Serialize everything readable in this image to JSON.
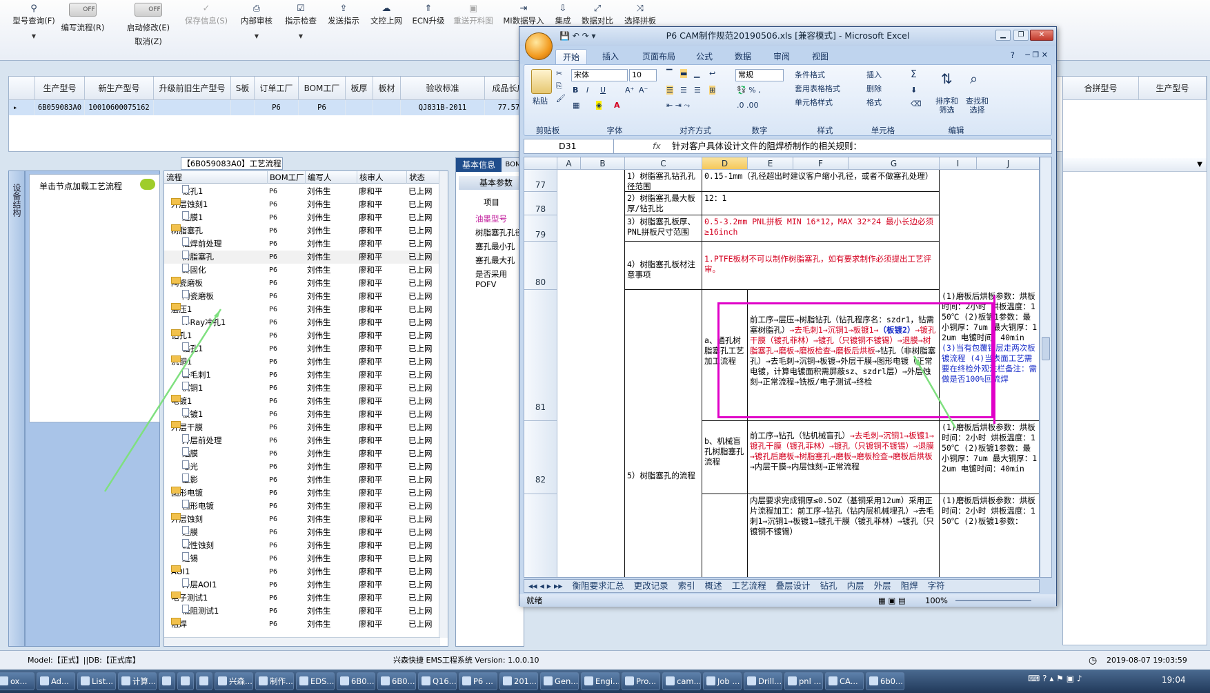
{
  "toolbar": {
    "query": "型号查询(F)",
    "edit_flow": "编写流程(R)",
    "start_modify": "启动修改(E)",
    "cancel": "取消(Z)",
    "toggle_off": "OFF",
    "save_info": "保存信息(S)",
    "internal_review": "内部审核",
    "instruction_check": "指示检查",
    "send_instruction": "发送指示",
    "upload_doc": "文控上网",
    "ecn_upgrade": "ECN升级",
    "resend_map": "重送开料图",
    "mi_import": "MI数据导入",
    "integrate": "集成",
    "data_compare": "数据对比",
    "choose_merge": "选择拼板"
  },
  "topgrid": {
    "headers": [
      "生产型号",
      "新生产型号",
      "升级前旧生产型号",
      "S板",
      "订单工厂",
      "BOM工厂",
      "板厚",
      "板材",
      "验收标准",
      "成品长度"
    ],
    "right_headers": [
      "合拼型号",
      "生产型号"
    ],
    "row": [
      "6B059083A0",
      "10010600075162",
      "",
      "",
      "P6",
      "P6",
      "",
      "",
      "QJ831B-2011",
      "77.57"
    ]
  },
  "left": {
    "side_label": "设备结构",
    "load_hint": "单击节点加载工艺流程",
    "tree_title": "【6B059083A0】工艺流程",
    "tree_headers": [
      "流程",
      "BOM工厂",
      "编写人",
      "核审人",
      "状态"
    ],
    "rows": [
      {
        "name": "镀孔1",
        "type": "doc",
        "lvl": 2,
        "fac": "P6",
        "w": "刘伟生",
        "r": "廖和平",
        "s": "已上网"
      },
      {
        "name": "外层蚀刻1",
        "type": "fold",
        "lvl": 1,
        "fac": "P6",
        "w": "刘伟生",
        "r": "廖和平",
        "s": "已上网"
      },
      {
        "name": "退膜1",
        "type": "doc",
        "lvl": 2,
        "fac": "P6",
        "w": "刘伟生",
        "r": "廖和平",
        "s": "已上网"
      },
      {
        "name": "树脂塞孔",
        "type": "fold",
        "lvl": 1,
        "fac": "P6",
        "w": "刘伟生",
        "r": "廖和平",
        "s": "已上网"
      },
      {
        "name": "阻焊前处理",
        "type": "doc",
        "lvl": 2,
        "fac": "P6",
        "w": "刘伟生",
        "r": "廖和平",
        "s": "已上网"
      },
      {
        "name": "树脂塞孔",
        "type": "doc",
        "lvl": 2,
        "fac": "P6",
        "w": "刘伟生",
        "r": "廖和平",
        "s": "已上网",
        "sel": true
      },
      {
        "name": "终固化",
        "type": "doc",
        "lvl": 2,
        "fac": "P6",
        "w": "刘伟生",
        "r": "廖和平",
        "s": "已上网"
      },
      {
        "name": "陶瓷磨板",
        "type": "fold",
        "lvl": 1,
        "fac": "P6",
        "w": "刘伟生",
        "r": "廖和平",
        "s": "已上网"
      },
      {
        "name": "陶瓷磨板",
        "type": "doc",
        "lvl": 2,
        "fac": "P6",
        "w": "刘伟生",
        "r": "廖和平",
        "s": "已上网"
      },
      {
        "name": "层压1",
        "type": "fold",
        "lvl": 1,
        "fac": "P6",
        "w": "刘伟生",
        "r": "廖和平",
        "s": "已上网"
      },
      {
        "name": "X-Ray冲孔1",
        "type": "doc",
        "lvl": 2,
        "fac": "P6",
        "w": "刘伟生",
        "r": "廖和平",
        "s": "已上网"
      },
      {
        "name": "钻孔1",
        "type": "fold",
        "lvl": 1,
        "fac": "P6",
        "w": "刘伟生",
        "r": "廖和平",
        "s": "已上网"
      },
      {
        "name": "钻孔1",
        "type": "doc",
        "lvl": 2,
        "fac": "P6",
        "w": "刘伟生",
        "r": "廖和平",
        "s": "已上网"
      },
      {
        "name": "沉铜1",
        "type": "fold",
        "lvl": 1,
        "fac": "P6",
        "w": "刘伟生",
        "r": "廖和平",
        "s": "已上网"
      },
      {
        "name": "去毛刺1",
        "type": "doc",
        "lvl": 2,
        "fac": "P6",
        "w": "刘伟生",
        "r": "廖和平",
        "s": "已上网"
      },
      {
        "name": "沉铜1",
        "type": "doc",
        "lvl": 2,
        "fac": "P6",
        "w": "刘伟生",
        "r": "廖和平",
        "s": "已上网"
      },
      {
        "name": "电镀1",
        "type": "fold",
        "lvl": 1,
        "fac": "P6",
        "w": "刘伟生",
        "r": "廖和平",
        "s": "已上网"
      },
      {
        "name": "板镀1",
        "type": "doc",
        "lvl": 2,
        "fac": "P6",
        "w": "刘伟生",
        "r": "廖和平",
        "s": "已上网"
      },
      {
        "name": "外层干膜",
        "type": "fold",
        "lvl": 1,
        "fac": "P6",
        "w": "刘伟生",
        "r": "廖和平",
        "s": "已上网"
      },
      {
        "name": "外层前处理",
        "type": "doc",
        "lvl": 2,
        "fac": "P6",
        "w": "刘伟生",
        "r": "廖和平",
        "s": "已上网"
      },
      {
        "name": "贴膜",
        "type": "doc",
        "lvl": 2,
        "fac": "P6",
        "w": "刘伟生",
        "r": "廖和平",
        "s": "已上网"
      },
      {
        "name": "曝光",
        "type": "doc",
        "lvl": 2,
        "fac": "P6",
        "w": "刘伟生",
        "r": "廖和平",
        "s": "已上网"
      },
      {
        "name": "显影",
        "type": "doc",
        "lvl": 2,
        "fac": "P6",
        "w": "刘伟生",
        "r": "廖和平",
        "s": "已上网"
      },
      {
        "name": "图形电镀",
        "type": "fold",
        "lvl": 1,
        "fac": "P6",
        "w": "刘伟生",
        "r": "廖和平",
        "s": "已上网"
      },
      {
        "name": "图形电镀",
        "type": "doc",
        "lvl": 2,
        "fac": "P6",
        "w": "刘伟生",
        "r": "廖和平",
        "s": "已上网"
      },
      {
        "name": "外层蚀刻",
        "type": "fold",
        "lvl": 1,
        "fac": "P6",
        "w": "刘伟生",
        "r": "廖和平",
        "s": "已上网"
      },
      {
        "name": "退膜",
        "type": "doc",
        "lvl": 2,
        "fac": "P6",
        "w": "刘伟生",
        "r": "廖和平",
        "s": "已上网"
      },
      {
        "name": "碱性蚀刻",
        "type": "doc",
        "lvl": 2,
        "fac": "P6",
        "w": "刘伟生",
        "r": "廖和平",
        "s": "已上网"
      },
      {
        "name": "退锡",
        "type": "doc",
        "lvl": 2,
        "fac": "P6",
        "w": "刘伟生",
        "r": "廖和平",
        "s": "已上网"
      },
      {
        "name": "AOI1",
        "type": "fold",
        "lvl": 1,
        "fac": "P6",
        "w": "刘伟生",
        "r": "廖和平",
        "s": "已上网"
      },
      {
        "name": "外层AOI1",
        "type": "doc",
        "lvl": 2,
        "fac": "P6",
        "w": "刘伟生",
        "r": "廖和平",
        "s": "已上网"
      },
      {
        "name": "电子测试1",
        "type": "fold",
        "lvl": 1,
        "fac": "P6",
        "w": "刘伟生",
        "r": "廖和平",
        "s": "已上网"
      },
      {
        "name": "低阻测试1",
        "type": "doc",
        "lvl": 2,
        "fac": "P6",
        "w": "刘伟生",
        "r": "廖和平",
        "s": "已上网"
      },
      {
        "name": "阻焊",
        "type": "fold",
        "lvl": 1,
        "fac": "P6",
        "w": "刘伟生",
        "r": "廖和平",
        "s": "已上网"
      }
    ]
  },
  "info": {
    "tab_basic": "基本信息",
    "tab_bom": "BOM",
    "basic_params": "基本参数",
    "item_header": "项目",
    "items": [
      "油墨型号",
      "树脂塞孔孔径",
      "塞孔最小孔",
      "塞孔最大孔",
      "是否采用POFV"
    ]
  },
  "excel": {
    "title": "P6 CAM制作规范20190506.xls  [兼容模式] - Microsoft Excel",
    "tabs": [
      "开始",
      "插入",
      "页面布局",
      "公式",
      "数据",
      "审阅",
      "视图"
    ],
    "font_name": "宋体",
    "font_size": "10",
    "number_format": "常规",
    "groups": [
      "剪贴板",
      "字体",
      "对齐方式",
      "数字",
      "样式",
      "单元格",
      "编辑"
    ],
    "paste": "粘贴",
    "cond_format": "条件格式",
    "table_format": "套用表格格式",
    "cell_style": "单元格样式",
    "insert": "插入",
    "delete": "删除",
    "format": "格式",
    "sort_filter": "排序和\n筛选",
    "find_select": "查找和\n选择",
    "name_box": "D31",
    "formula": "针对客户具体设计文件的阻焊桥制作的相关规则：",
    "columns": [
      "A",
      "B",
      "C",
      "D",
      "E",
      "F",
      "G",
      "I",
      "J"
    ],
    "rows": {
      "r77": {
        "num": "77",
        "c": "1）树脂塞孔钻孔孔径范围",
        "d": "0.15-1mm（孔径超出时建议客户缩小孔径，或者不做塞孔处理）"
      },
      "r78": {
        "num": "78",
        "c": "2）树脂塞孔最大板厚/钻孔比",
        "d": "12：1"
      },
      "r79": {
        "num": "79",
        "c": "3）树脂塞孔板厚、PNL拼板尺寸范围",
        "d": "0.5-3.2mm  PNL拼板  MIN 16*12，MAX 32*24 最小长边必须≥16inch"
      },
      "r80": {
        "num": "80",
        "c": "4）树脂塞孔板材注意事项",
        "d": "1.PTFE板材不可以制作树脂塞孔，如有要求制作必须提出工艺评审。"
      },
      "r81": {
        "num": "81",
        "d": "a、通孔树脂塞孔工艺加工流程",
        "e_pre": "前工序→层压→树脂钻孔（钻孔程序名：szdr1，钻需塞树脂孔）",
        "e_red1": "→去毛刺1→沉铜1→板镀1→",
        "e_blue": "（板镀2）",
        "e_red2": "→镀孔干膜（镀孔菲林）→镀孔（只镀铜不镀锡）→退膜→树脂塞孔→磨板→磨板检查→磨板后烘板",
        "e_post": "→钻孔（非树脂塞孔）→去毛刺→沉铜→板镀→外层干膜→图形电镀（正常电镀，计算电镀面积需屏蔽sz、szdrl层）→外层蚀刻→正常流程→铣板/电子测试→终检",
        "i": "(1)磨板后烘板参数：烘板时间：2小时 烘板温度：150℃ (2)板镀1参数：最小铜厚：7um 最大铜厚：12um 电镀时间：40min",
        "i_blue": "(3)当有包覆铜层走两次板镀流程 (4)当表面工艺需要在终检外观注栏备注：需做是否100%回流焊"
      },
      "r82": {
        "num": "82",
        "c": "5）树脂塞孔的流程",
        "d": "b、机械盲孔树脂塞孔流程",
        "e_pre": "前工序→钻孔（钻机械盲孔）",
        "e_red": "→去毛刺→沉铜1→板镀1→镀孔干膜（镀孔菲林）→镀孔（只镀铜不镀锡）→退膜→镀孔后磨板→树脂塞孔→磨板→磨板检查→磨板后烘板",
        "e_post": "→内层干膜→内层蚀刻→正常流程",
        "i": "(1)磨板后烘板参数：烘板时间：2小时 烘板温度：150℃ (2)板镀1参数：最小铜厚：7um 最大铜厚：12um 电镀时间：40min"
      },
      "r83": {
        "e": "内层要求完成铜厚≤0.5OZ（基铜采用12um）采用正片流程加工：前工序→钻孔（钻内层机械埋孔）→去毛刺1→沉铜1→板镀1→镀孔干膜（镀孔菲林）→镀孔（只镀铜不镀锡）",
        "i": "(1)磨板后烘板参数：烘板时间：2小时 烘板温度：150℃ (2)板镀1参数："
      }
    },
    "sheet_tabs": [
      "衡阻要求汇总",
      "更改记录",
      "索引",
      "概述",
      "工艺流程",
      "叠层设计",
      "钻孔",
      "内层",
      "外层",
      "阻焊",
      "字符"
    ],
    "status": "就绪",
    "zoom": "100%"
  },
  "statusbar": {
    "model": "Model:【正式】||DB:【正式库】",
    "app": "兴森快捷 EMS工程系统 Version: 1.0.0.10",
    "datetime": "2019-08-07 19:03:59"
  },
  "taskbar": {
    "items": [
      "ox...",
      "Ad...",
      "List...",
      "计算...",
      "",
      "",
      "",
      "兴森...",
      "制作...",
      "EDS...",
      "6B0...",
      "6B0...",
      "Q16...",
      "P6 ...",
      "201...",
      "Gen...",
      "Engi...",
      "Pro...",
      "cam...",
      "Job ...",
      "Drill...",
      "pnl ...",
      "CA...",
      "6b0..."
    ],
    "time": "19:04"
  },
  "colors": {
    "accent": "#cfe1f7",
    "excel_bg": "#c6d8ee",
    "highlight_box": "#e000c8",
    "arrow": "#7fe07f",
    "red_text": "#d4001f",
    "blue_text": "#1a2fc9"
  }
}
